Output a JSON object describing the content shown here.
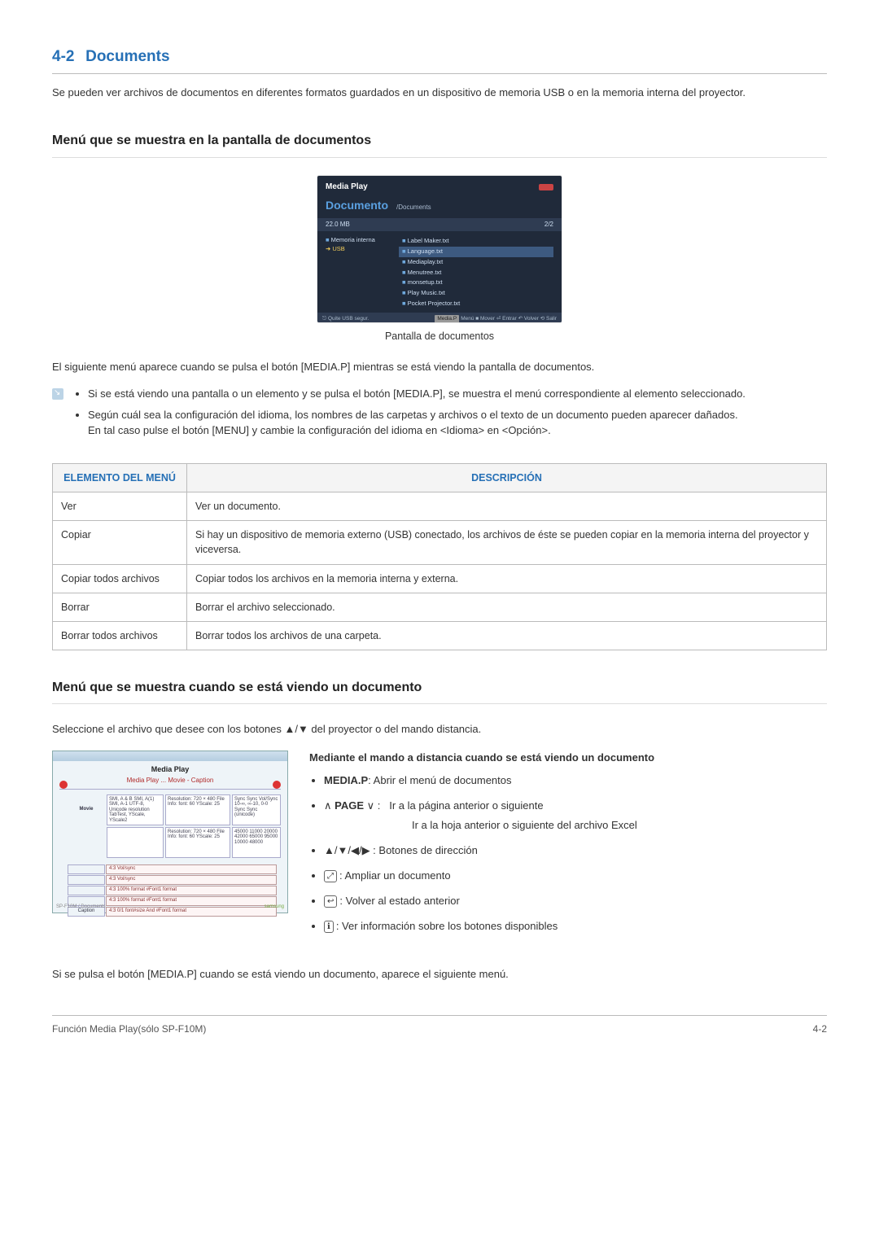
{
  "header": {
    "num": "4-2",
    "title": "Documents"
  },
  "intro": "Se pueden ver archivos de documentos en diferentes formatos guardados en un dispositivo de memoria USB o en la memoria interna del proyector.",
  "section1": {
    "heading": "Menú que se muestra en la pantalla de documentos",
    "caption": "Pantalla de documentos",
    "after_shot": "El siguiente menú aparece cuando se pulsa el botón [MEDIA.P] mientras se está viendo la pantalla de documentos.",
    "notes": [
      "Si se está viendo una pantalla o un elemento y se pulsa el botón [MEDIA.P], se muestra el menú correspondiente al elemento seleccionado.",
      "Según cuál sea la configuración del idioma, los nombres de las carpetas y archivos o el texto de un documento pueden aparecer dañados.\nEn tal caso pulse el botón [MENU] y cambie la configuración del idioma en <Idioma> en <Opción>."
    ],
    "table": {
      "headers": [
        "ELEMENTO DEL MENÚ",
        "DESCRIPCIÓN"
      ],
      "rows": [
        [
          "Ver",
          "Ver un documento."
        ],
        [
          "Copiar",
          "Si hay un dispositivo de memoria externo (USB) conectado, los archivos de éste se pueden copiar en la memoria interna del proyector y viceversa."
        ],
        [
          "Copiar todos archivos",
          "Copiar todos los archivos en la memoria interna y externa."
        ],
        [
          "Borrar",
          "Borrar el archivo seleccionado."
        ],
        [
          "Borrar todos archivos",
          "Borrar todos los archivos de una carpeta."
        ]
      ]
    }
  },
  "mock1": {
    "mp": "Media Play",
    "doc": "Documento",
    "path": "/Documents",
    "size": "22.0 MB",
    "pager": "2/2",
    "src_internal": "Memoria interna",
    "src_usb": "USB",
    "files": [
      "Label Maker.txt",
      "Language.txt",
      "Mediaplay.txt",
      "Menutree.txt",
      "monsetup.txt",
      "Play Music.txt",
      "Pocket Projector.txt"
    ],
    "hl_index": 1,
    "remove": "Quite USB segur.",
    "mediap": "Media.P",
    "hints": "Menú  ■ Mover  ⏎ Entrar  ↶ Volver  ⟲ Salir"
  },
  "section2": {
    "heading": "Menú que se muestra cuando se está viendo un documento",
    "lead": "Seleccione el archivo que desee con los botones ▲/▼ del proyector o del mando distancia.",
    "subhead": "Mediante el mando a distancia cuando se está viendo un documento",
    "items": {
      "mediap_label": "MEDIA.P",
      "mediap_desc": ": Abrir el menú de documentos",
      "page_prefix": "∧ ",
      "page_label": "PAGE",
      "page_suffix": " ∨ :",
      "page_desc_a": "Ir a la página anterior o siguiente",
      "page_desc_b": "Ir a la hoja anterior o siguiente del archivo Excel",
      "arrows": "▲/▼/◀/▶ : Botones de dirección",
      "zoom_desc": ": Ampliar un documento",
      "back_desc": ": Volver al estado anterior",
      "info_desc": ": Ver información sobre los botones disponibles"
    },
    "icons": {
      "zoom": "⤢",
      "back": "↩",
      "info": "ℹ"
    },
    "closing": "Si se pulsa el botón [MEDIA.P] cuando se está viendo un documento, aparece el siguiente menú."
  },
  "mock2": {
    "title": "Media Play",
    "subtitle": "Media Play ... Movie - Caption",
    "row1_label": "Movie",
    "row2_label": "Caption",
    "cell_a": "SMI, A & B\nSMI, A(1)\nSMI, A-1\nUTF-8, Unicode\nresolution\nTabTest, YScale, YScale2",
    "cell_b": "Resolution: 720 × 480\nFile Info: font: 60\nYScale: 25",
    "cell_c": "Sync\nSync\nVol/Sync\n10-∞, ∞-10, 0-0\nSync\nSync (unicode)",
    "cell_d": "Resolution: 720 × 480\nFile Info: font: 60\nYScale: 25",
    "cell_e": "45000\n11000\n20000\n42000\n65000\n95000\n10000\n48000",
    "low": [
      [
        "4:3 Vol/sync",
        ""
      ],
      [
        "4:3 Vol/sync",
        ""
      ],
      [
        "4:3 100% format",
        "#Font1 format"
      ],
      [
        "4:3 100% format",
        "#Font1 format"
      ],
      [
        "4:3 0/1 font#size And",
        "#Font1 format"
      ]
    ],
    "cornerL": "SP-F10M / Documents",
    "cornerR": "samsung"
  },
  "footer": {
    "left": "Función Media Play(sólo SP-F10M)",
    "right": "4-2"
  }
}
